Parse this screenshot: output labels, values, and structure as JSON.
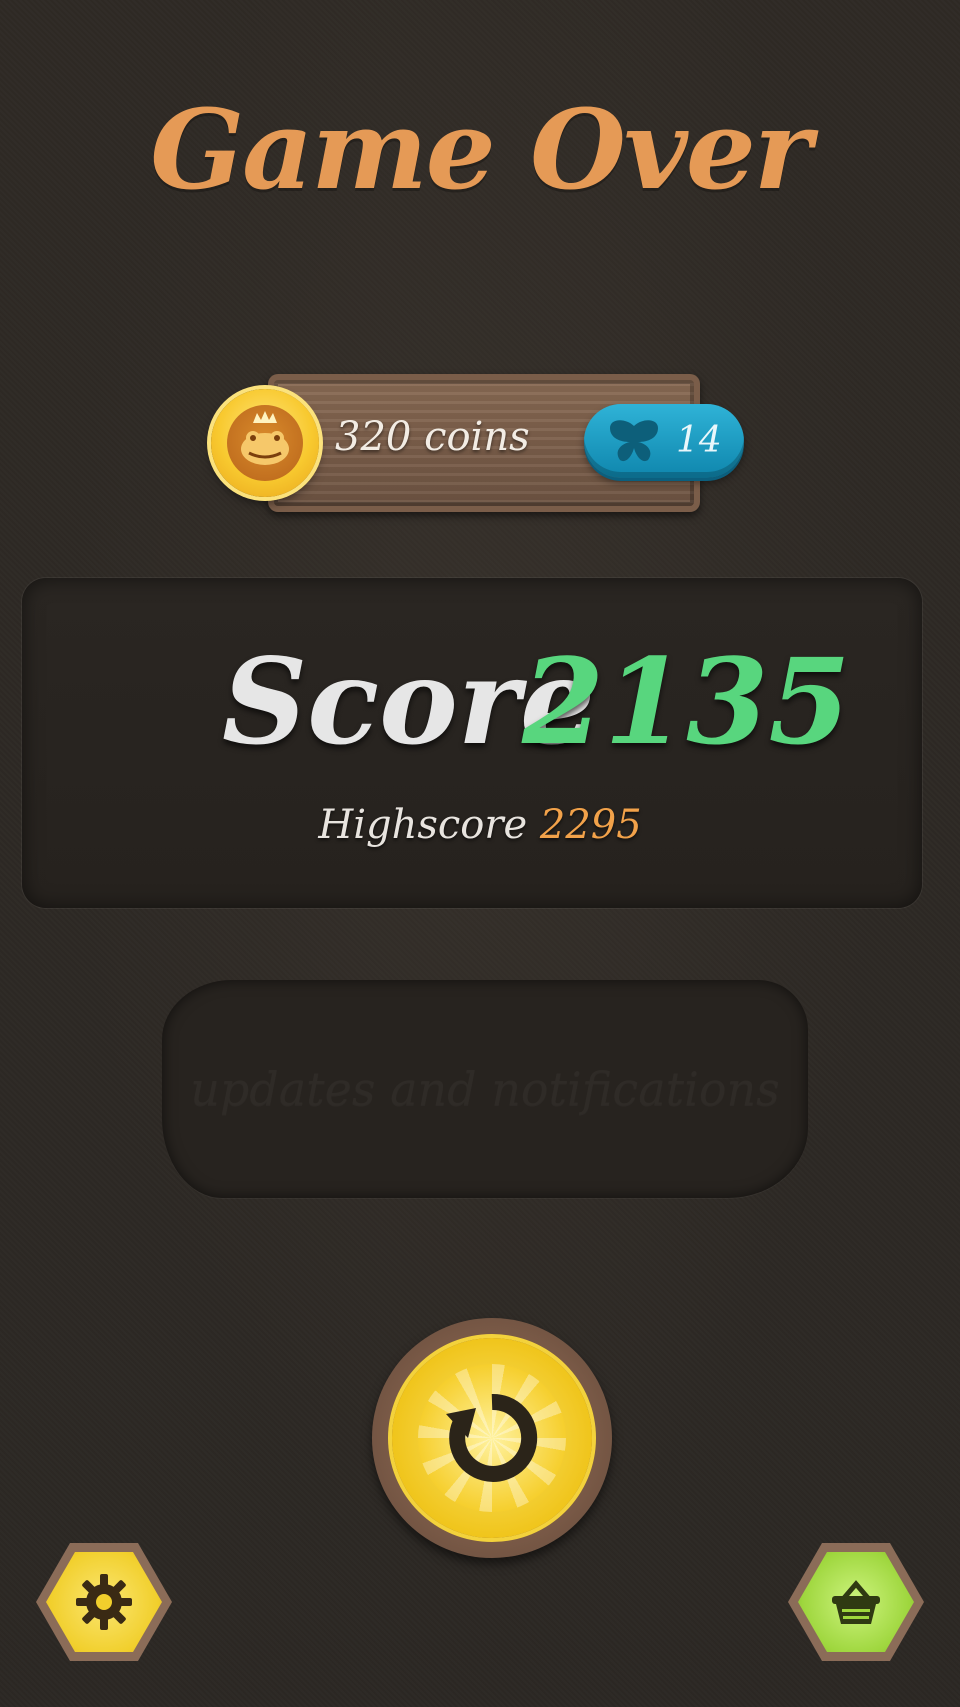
{
  "title": "Game Over",
  "currency": {
    "coins_label": "320 coins",
    "butterflies": "14",
    "coin_icon": "frog-king-coin-icon",
    "butterfly_icon": "butterfly-icon"
  },
  "score": {
    "label": "Score",
    "value": "2135",
    "highscore_label": "Highscore",
    "highscore_value": "2295"
  },
  "notifications": {
    "text": "updates and notifications"
  },
  "buttons": {
    "replay_icon": "replay-icon",
    "settings_icon": "gear-icon",
    "shop_icon": "basket-icon"
  },
  "colors": {
    "title": "#e59a56",
    "score_value": "#58d67e",
    "highscore_value": "#f2a24a",
    "butterfly_pill": "#1c9fc6",
    "replay_button": "#f0c51c",
    "shop_button": "#9ed63d"
  }
}
